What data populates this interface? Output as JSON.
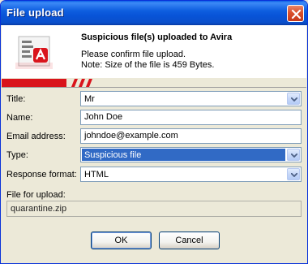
{
  "window": {
    "title": "File upload"
  },
  "header": {
    "title": "Suspicious file(s) uploaded to Avira",
    "line1": "Please confirm file upload.",
    "line2": "Note: Size of the file is 459 Bytes."
  },
  "form": {
    "title": {
      "label": "Title:",
      "value": "Mr"
    },
    "name": {
      "label": "Name:",
      "value": "John Doe"
    },
    "email": {
      "label": "Email address:",
      "value": "johndoe@example.com"
    },
    "type": {
      "label": "Type:",
      "value": "Suspicious file"
    },
    "response_format": {
      "label": "Response format:",
      "value": "HTML"
    },
    "file_upload": {
      "label": "File for upload:",
      "value": "quarantine.zip"
    }
  },
  "buttons": {
    "ok": "OK",
    "cancel": "Cancel"
  },
  "colors": {
    "avira_red": "#d9141c",
    "title_blue": "#0a5ee6",
    "selection": "#316ac5"
  },
  "icons": {
    "logo": "avira-file-icon",
    "close": "close-icon",
    "dropdown": "chevron-down-icon"
  }
}
